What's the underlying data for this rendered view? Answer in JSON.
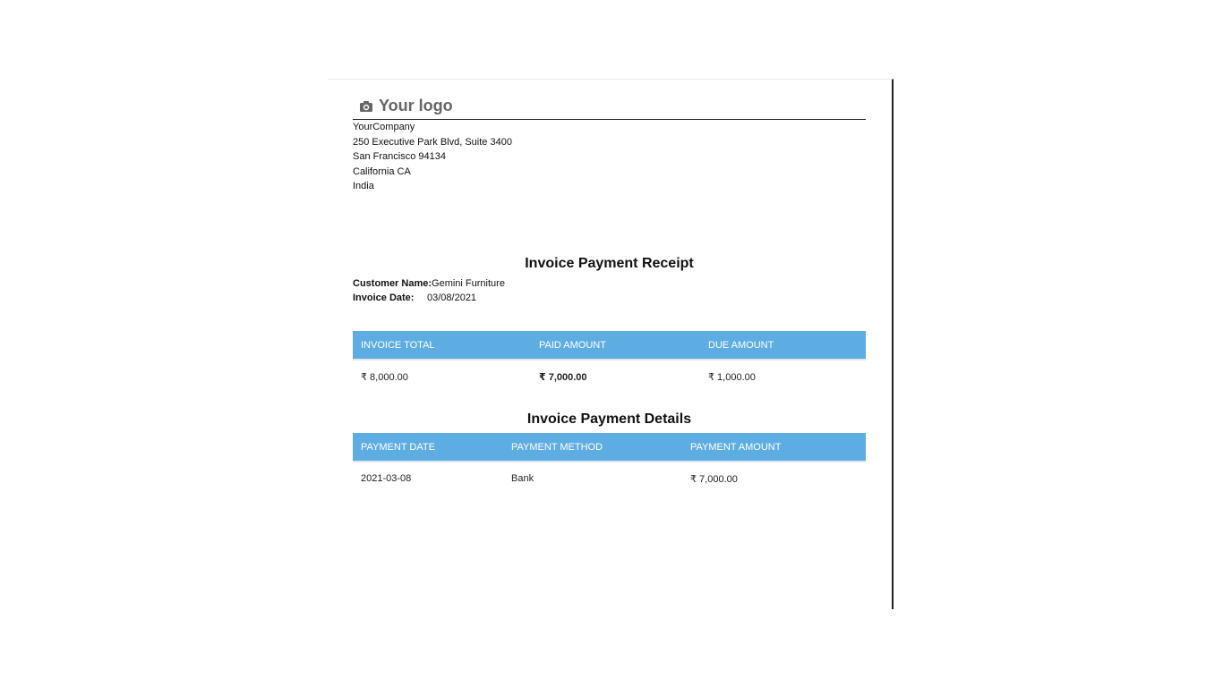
{
  "header": {
    "logo_text": "Your logo",
    "logo_icon": "camera-icon"
  },
  "company": {
    "name": "YourCompany",
    "street": "250 Executive Park Blvd, Suite 3400",
    "city_zip": "San Francisco 94134",
    "state": "California CA",
    "country": "India"
  },
  "receipt": {
    "title": "Invoice Payment Receipt",
    "customer_label": "Customer Name:",
    "customer_value": "Gemini Furniture",
    "date_label": "Invoice Date:",
    "date_value": "03/08/2021",
    "table": {
      "headers": [
        "INVOICE TOTAL",
        "PAID AMOUNT",
        "DUE AMOUNT"
      ],
      "row": [
        "₹ 8,000.00",
        "₹ 7,000.00",
        "₹ 1,000.00"
      ]
    }
  },
  "details": {
    "title": "Invoice Payment Details",
    "table": {
      "headers": [
        "PAYMENT DATE",
        "PAYMENT METHOD",
        "PAYMENT AMOUNT"
      ],
      "rows": [
        [
          "2021-03-08",
          "Bank",
          "₹ 7,000.00"
        ]
      ]
    }
  },
  "colors": {
    "table_header_bg": "#5dade2",
    "table_header_text": "#ffffff"
  }
}
